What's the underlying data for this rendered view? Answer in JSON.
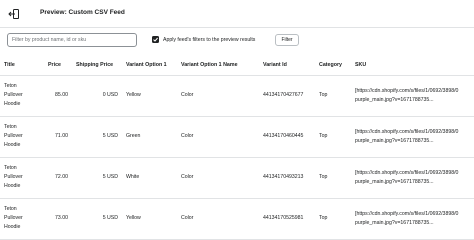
{
  "header": {
    "title": "Preview: Custom CSV Feed",
    "back_icon": "exit-icon"
  },
  "toolbar": {
    "search_placeholder": "Filter by product name, id or sku",
    "apply_filters_label": "Apply feed's filters to the preview results",
    "apply_filters_checked": true,
    "filter_button_label": "Filter"
  },
  "table": {
    "columns": [
      "Title",
      "Price",
      "Shipping Price",
      "Variant Option 1",
      "Variant Option 1 Name",
      "Variant Id",
      "Category",
      "SKU"
    ],
    "rows": [
      {
        "title": "Teton\nPullover\nHoodie",
        "price": "85.00",
        "shipping": "0 USD",
        "option": "Yellow",
        "option_name": "Color",
        "variant_id": "44134170427677",
        "category": "Top",
        "sku": "[https://cdn.shopify.com/s/files/1/0692/3898/0\npurple_main.jpg?v=1671788735..."
      },
      {
        "title": "Teton\nPullover\nHoodie",
        "price": "71.00",
        "shipping": "5 USD",
        "option": "Green",
        "option_name": "Color",
        "variant_id": "44134170460445",
        "category": "Top",
        "sku": "[https://cdn.shopify.com/s/files/1/0692/3898/0\npurple_main.jpg?v=1671788735..."
      },
      {
        "title": "Teton\nPullover\nHoodie",
        "price": "72.00",
        "shipping": "5 USD",
        "option": "White",
        "option_name": "Color",
        "variant_id": "44134170493213",
        "category": "Top",
        "sku": "[https://cdn.shopify.com/s/files/1/0692/3898/0\npurple_main.jpg?v=1671788735..."
      },
      {
        "title": "Teton\nPullover\nHoodie",
        "price": "73.00",
        "shipping": "5 USD",
        "option": "Yellow",
        "option_name": "Color",
        "variant_id": "44134170525981",
        "category": "Top",
        "sku": "[https://cdn.shopify.com/s/files/1/0692/3898/0\npurple_main.jpg?v=1671788735..."
      }
    ]
  }
}
